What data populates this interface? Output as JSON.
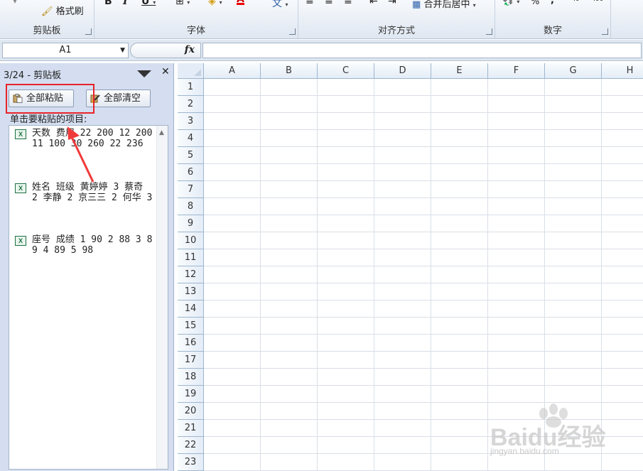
{
  "ribbon": {
    "groups": [
      {
        "label": "剪贴板"
      },
      {
        "label": "字体"
      },
      {
        "label": "对齐方式"
      },
      {
        "label": "数字"
      }
    ],
    "format_painter_label": "格式刷",
    "merge_center_label": "合并后居中",
    "percent_label": "%",
    "comma_label": ","
  },
  "formula_bar": {
    "name_box": "A1",
    "fx_label": "fx",
    "formula_value": ""
  },
  "clipboard_pane": {
    "title": "3/24 - 剪贴板",
    "paste_all_label": "全部粘贴",
    "clear_all_label": "全部清空",
    "hint": "单击要粘贴的项目:",
    "items": [
      {
        "text": "天数 费用 22 200 12 200 11 100 30 260 22 236"
      },
      {
        "text": "姓名 班级 黄婷婷 3 蔡奇 2 李静 2 京三三 2 何华 3"
      },
      {
        "text": "座号 成绩 1 90 2 88 3 89 4 89 5 98"
      }
    ],
    "item_icon": "excel-icon"
  },
  "sheet": {
    "columns": [
      "A",
      "B",
      "C",
      "D",
      "E",
      "F",
      "G",
      "H"
    ],
    "rows": [
      "1",
      "2",
      "3",
      "4",
      "5",
      "6",
      "7",
      "8",
      "9",
      "10",
      "11",
      "12",
      "13",
      "14",
      "15",
      "16",
      "17",
      "18",
      "19",
      "20",
      "21",
      "22",
      "23"
    ]
  },
  "watermark": {
    "text": "Baidu经验",
    "sub": "jingyan.baidu.com"
  },
  "colors": {
    "highlight": "#e8232a",
    "pane_bg": "#d4def0",
    "header_bg": "#e4ecf7"
  }
}
